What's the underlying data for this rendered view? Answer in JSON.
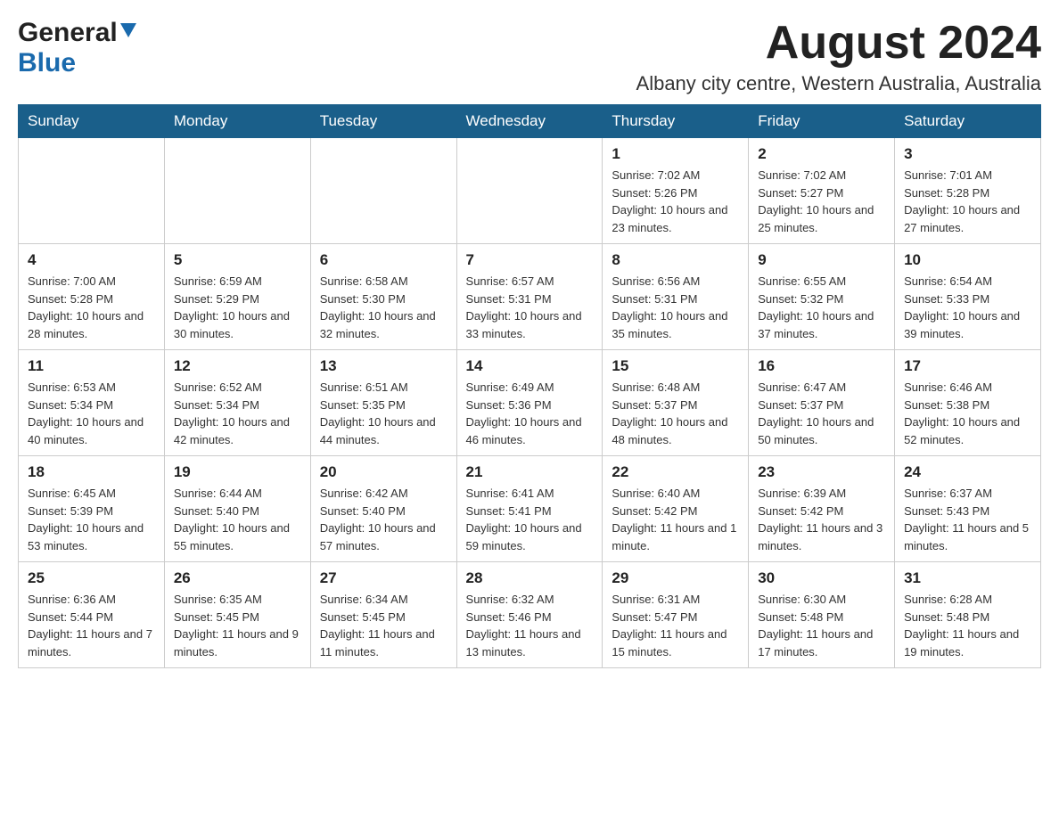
{
  "header": {
    "logo_general": "General",
    "logo_blue": "Blue",
    "month_year": "August 2024",
    "location": "Albany city centre, Western Australia, Australia"
  },
  "days_of_week": [
    "Sunday",
    "Monday",
    "Tuesday",
    "Wednesday",
    "Thursday",
    "Friday",
    "Saturday"
  ],
  "weeks": [
    [
      {
        "day": "",
        "info": ""
      },
      {
        "day": "",
        "info": ""
      },
      {
        "day": "",
        "info": ""
      },
      {
        "day": "",
        "info": ""
      },
      {
        "day": "1",
        "info": "Sunrise: 7:02 AM\nSunset: 5:26 PM\nDaylight: 10 hours and 23 minutes."
      },
      {
        "day": "2",
        "info": "Sunrise: 7:02 AM\nSunset: 5:27 PM\nDaylight: 10 hours and 25 minutes."
      },
      {
        "day": "3",
        "info": "Sunrise: 7:01 AM\nSunset: 5:28 PM\nDaylight: 10 hours and 27 minutes."
      }
    ],
    [
      {
        "day": "4",
        "info": "Sunrise: 7:00 AM\nSunset: 5:28 PM\nDaylight: 10 hours and 28 minutes."
      },
      {
        "day": "5",
        "info": "Sunrise: 6:59 AM\nSunset: 5:29 PM\nDaylight: 10 hours and 30 minutes."
      },
      {
        "day": "6",
        "info": "Sunrise: 6:58 AM\nSunset: 5:30 PM\nDaylight: 10 hours and 32 minutes."
      },
      {
        "day": "7",
        "info": "Sunrise: 6:57 AM\nSunset: 5:31 PM\nDaylight: 10 hours and 33 minutes."
      },
      {
        "day": "8",
        "info": "Sunrise: 6:56 AM\nSunset: 5:31 PM\nDaylight: 10 hours and 35 minutes."
      },
      {
        "day": "9",
        "info": "Sunrise: 6:55 AM\nSunset: 5:32 PM\nDaylight: 10 hours and 37 minutes."
      },
      {
        "day": "10",
        "info": "Sunrise: 6:54 AM\nSunset: 5:33 PM\nDaylight: 10 hours and 39 minutes."
      }
    ],
    [
      {
        "day": "11",
        "info": "Sunrise: 6:53 AM\nSunset: 5:34 PM\nDaylight: 10 hours and 40 minutes."
      },
      {
        "day": "12",
        "info": "Sunrise: 6:52 AM\nSunset: 5:34 PM\nDaylight: 10 hours and 42 minutes."
      },
      {
        "day": "13",
        "info": "Sunrise: 6:51 AM\nSunset: 5:35 PM\nDaylight: 10 hours and 44 minutes."
      },
      {
        "day": "14",
        "info": "Sunrise: 6:49 AM\nSunset: 5:36 PM\nDaylight: 10 hours and 46 minutes."
      },
      {
        "day": "15",
        "info": "Sunrise: 6:48 AM\nSunset: 5:37 PM\nDaylight: 10 hours and 48 minutes."
      },
      {
        "day": "16",
        "info": "Sunrise: 6:47 AM\nSunset: 5:37 PM\nDaylight: 10 hours and 50 minutes."
      },
      {
        "day": "17",
        "info": "Sunrise: 6:46 AM\nSunset: 5:38 PM\nDaylight: 10 hours and 52 minutes."
      }
    ],
    [
      {
        "day": "18",
        "info": "Sunrise: 6:45 AM\nSunset: 5:39 PM\nDaylight: 10 hours and 53 minutes."
      },
      {
        "day": "19",
        "info": "Sunrise: 6:44 AM\nSunset: 5:40 PM\nDaylight: 10 hours and 55 minutes."
      },
      {
        "day": "20",
        "info": "Sunrise: 6:42 AM\nSunset: 5:40 PM\nDaylight: 10 hours and 57 minutes."
      },
      {
        "day": "21",
        "info": "Sunrise: 6:41 AM\nSunset: 5:41 PM\nDaylight: 10 hours and 59 minutes."
      },
      {
        "day": "22",
        "info": "Sunrise: 6:40 AM\nSunset: 5:42 PM\nDaylight: 11 hours and 1 minute."
      },
      {
        "day": "23",
        "info": "Sunrise: 6:39 AM\nSunset: 5:42 PM\nDaylight: 11 hours and 3 minutes."
      },
      {
        "day": "24",
        "info": "Sunrise: 6:37 AM\nSunset: 5:43 PM\nDaylight: 11 hours and 5 minutes."
      }
    ],
    [
      {
        "day": "25",
        "info": "Sunrise: 6:36 AM\nSunset: 5:44 PM\nDaylight: 11 hours and 7 minutes."
      },
      {
        "day": "26",
        "info": "Sunrise: 6:35 AM\nSunset: 5:45 PM\nDaylight: 11 hours and 9 minutes."
      },
      {
        "day": "27",
        "info": "Sunrise: 6:34 AM\nSunset: 5:45 PM\nDaylight: 11 hours and 11 minutes."
      },
      {
        "day": "28",
        "info": "Sunrise: 6:32 AM\nSunset: 5:46 PM\nDaylight: 11 hours and 13 minutes."
      },
      {
        "day": "29",
        "info": "Sunrise: 6:31 AM\nSunset: 5:47 PM\nDaylight: 11 hours and 15 minutes."
      },
      {
        "day": "30",
        "info": "Sunrise: 6:30 AM\nSunset: 5:48 PM\nDaylight: 11 hours and 17 minutes."
      },
      {
        "day": "31",
        "info": "Sunrise: 6:28 AM\nSunset: 5:48 PM\nDaylight: 11 hours and 19 minutes."
      }
    ]
  ]
}
